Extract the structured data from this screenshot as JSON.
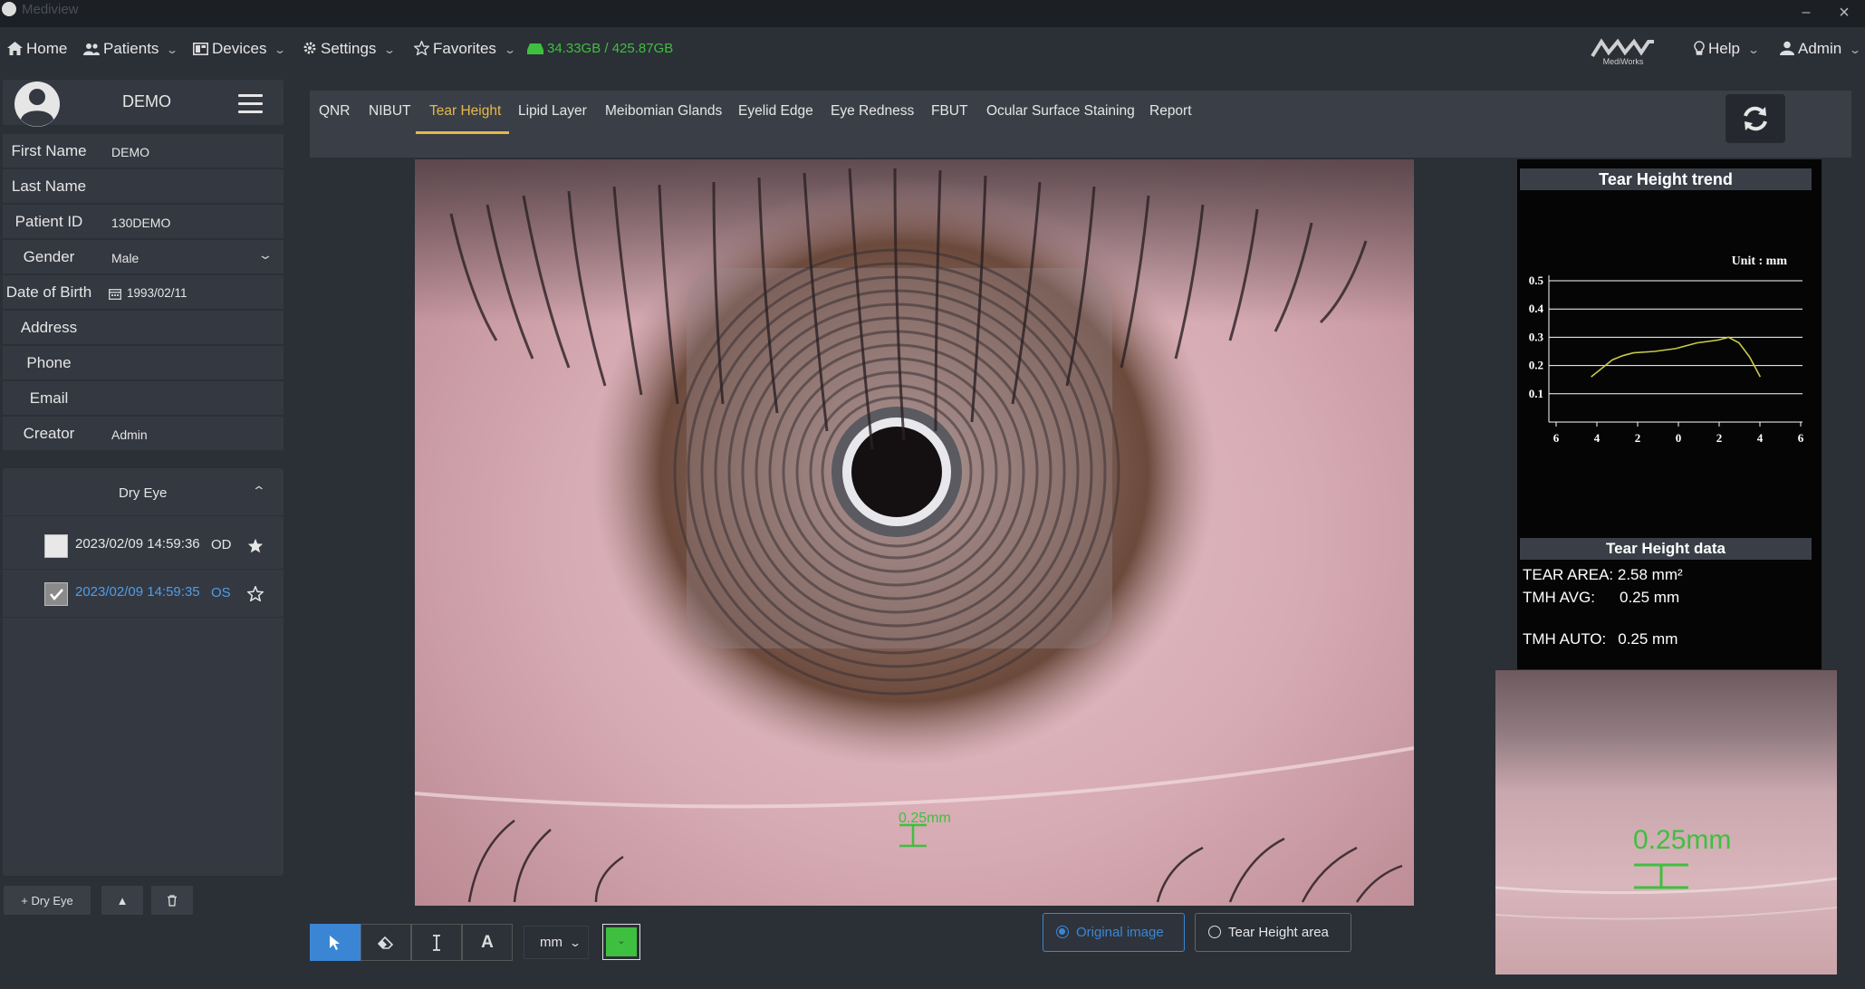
{
  "window": {
    "title": "Mediview",
    "minimize": "–",
    "close": "×"
  },
  "nav": {
    "home": "Home",
    "patients": "Patients",
    "devices": "Devices",
    "settings": "Settings",
    "favorites": "Favorites",
    "storage": "34.33GB / 425.87GB",
    "help": "Help",
    "admin": "Admin",
    "brand": "MediWorks"
  },
  "patient": {
    "name": "DEMO",
    "fields": [
      {
        "label": "First Name",
        "value": "DEMO"
      },
      {
        "label": "Last Name",
        "value": ""
      },
      {
        "label": "Patient ID",
        "value": "130DEMO"
      },
      {
        "label": "Gender",
        "value": "Male"
      },
      {
        "label": "Date of Birth",
        "value": "1993/02/11"
      },
      {
        "label": "Address",
        "value": ""
      },
      {
        "label": "Phone",
        "value": ""
      },
      {
        "label": "Email",
        "value": ""
      },
      {
        "label": "Creator",
        "value": "Admin"
      }
    ]
  },
  "records": {
    "group": "Dry Eye",
    "items": [
      {
        "date": "2023/02/09 14:59:36",
        "eye": "OD",
        "checked": false
      },
      {
        "date": "2023/02/09 14:59:35",
        "eye": "OS",
        "checked": true
      }
    ],
    "add_label": "+ Dry Eye"
  },
  "tabs": [
    "QNR",
    "NIBUT",
    "Tear Height",
    "Lipid Layer",
    "Meibomian Glands",
    "Eyelid Edge",
    "Eye Redness",
    "FBUT",
    "Ocular Surface Staining",
    "Report"
  ],
  "active_tab": "Tear Height",
  "measurement": {
    "label": "0.25mm"
  },
  "trend": {
    "title": "Tear Height trend",
    "unit": "Unit : mm"
  },
  "chart_data": {
    "type": "line",
    "title": "Tear Height trend",
    "unit": "Unit : mm",
    "x_ticks": [
      "6",
      "4",
      "2",
      "0",
      "2",
      "4",
      "6"
    ],
    "y_ticks": [
      "0.1",
      "0.2",
      "0.3",
      "0.4",
      "0.5"
    ],
    "ylim": [
      0,
      0.5
    ],
    "xlim": [
      -6,
      6
    ],
    "grid": true,
    "series": [
      {
        "x": [
          -4,
          -3.5,
          -3,
          -2.5,
          -2,
          -1,
          0,
          1,
          2,
          2.5,
          3,
          3.5,
          4
        ],
        "y": [
          0.16,
          0.19,
          0.22,
          0.235,
          0.245,
          0.25,
          0.26,
          0.28,
          0.29,
          0.3,
          0.28,
          0.23,
          0.16
        ]
      }
    ],
    "color": "#c8c84a"
  },
  "tear_data": {
    "title": "Tear Height data",
    "rows": [
      {
        "label": "TEAR AREA:",
        "value": "2.58 mm²"
      },
      {
        "label": "TMH AVG:",
        "value": "0.25 mm"
      },
      {
        "label": "TMH AUTO:",
        "value": "0.25 mm"
      }
    ]
  },
  "toolbar": {
    "unit": "mm",
    "original_image": "Original image",
    "tear_area": "Tear Height area",
    "text_tool": "A"
  }
}
